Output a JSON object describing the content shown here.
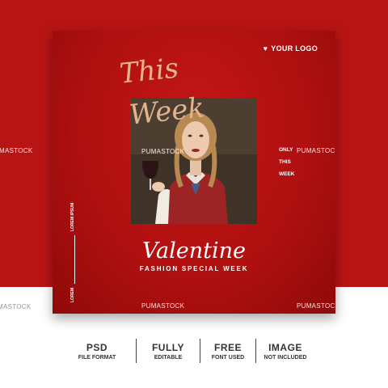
{
  "logo": {
    "text": "YOUR LOGO",
    "icon": "heart-icon"
  },
  "script_heading": {
    "line1": "This",
    "line2": "Week"
  },
  "side_text": [
    "ONLY",
    "THIS",
    "WEEK"
  ],
  "vertical_text": {
    "top": "LOREM IPSUM",
    "bottom": "LOREM"
  },
  "title": "Valentine",
  "subtitle": "FASHION SPECIAL WEEK",
  "watermark": "PUMASTOCK",
  "watermark_partial": "MASTOCK",
  "features": [
    {
      "title": "PSD",
      "sub": "FILE FORMAT"
    },
    {
      "title": "FULLY",
      "sub": "EDITABLE"
    },
    {
      "title": "FREE",
      "sub": "FONT USED"
    },
    {
      "title": "IMAGE",
      "sub": "NOT INCLUDED"
    }
  ],
  "colors": {
    "background_red": "#b81414",
    "card_red": "#c41616",
    "script_gold": "#e3b48c",
    "text_dark": "#333333"
  }
}
